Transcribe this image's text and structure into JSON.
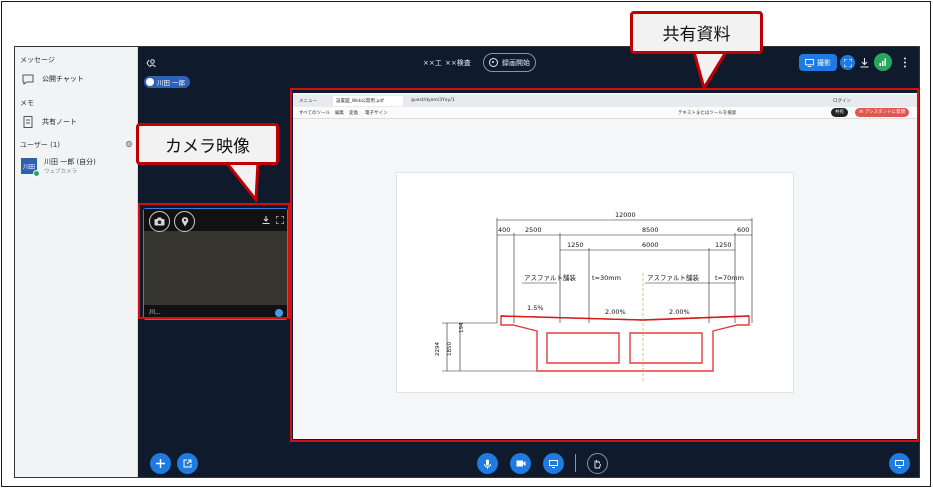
{
  "sidebar": {
    "messages_label": "メッセージ",
    "public_chat": "公開チャット",
    "memo_label": "メモ",
    "shared_note": "共有ノート",
    "users_label": "ユーザー (1)",
    "user": {
      "avatar_text": "川田",
      "name": "川田 一郎 (自分)",
      "sub": "ウェブカメラ"
    }
  },
  "topbar": {
    "title1": "××工",
    "title2": "××検査",
    "record": "録画開始",
    "presenter_name": "川田 一郎",
    "share_label": "撮影"
  },
  "camera": {
    "user_label": "川..."
  },
  "browser": {
    "tabs": [
      "メニュー",
      "設置図_Web公開用.pdf",
      "guest/dyom/3Yxy/1"
    ],
    "toolbar_items": [
      "すべてのツール",
      "編集",
      "変換",
      "電子サイン"
    ],
    "search_text": "テキストまたはツールを検索",
    "share": "共有",
    "ai_label": "AI アシスタントに質問",
    "login": "ログイン"
  },
  "drawing": {
    "dims_top": "12000",
    "dims_row2": [
      "400",
      "2500",
      "8500",
      "600"
    ],
    "dims_row3": [
      "1250",
      "6000",
      "1250"
    ],
    "asphalt1": "アスファルト舗装",
    "thick1": "t=30mm",
    "asphalt2": "アスファルト舗装",
    "thick2": "t=70mm",
    "slope1": "1.5%",
    "slope2": "2.00%",
    "slope3": "2.00%",
    "side_dims": [
      "100",
      "250",
      "250",
      "194",
      "250",
      "1850",
      "2294"
    ]
  },
  "annotations": {
    "shared_material": "共有資料",
    "camera_video": "カメラ映像"
  },
  "colors": {
    "main_bg": "#0f1b2d",
    "accent": "#1f7be0",
    "callout_red": "#c00000",
    "sidebar_bg": "#f2f3f5"
  }
}
